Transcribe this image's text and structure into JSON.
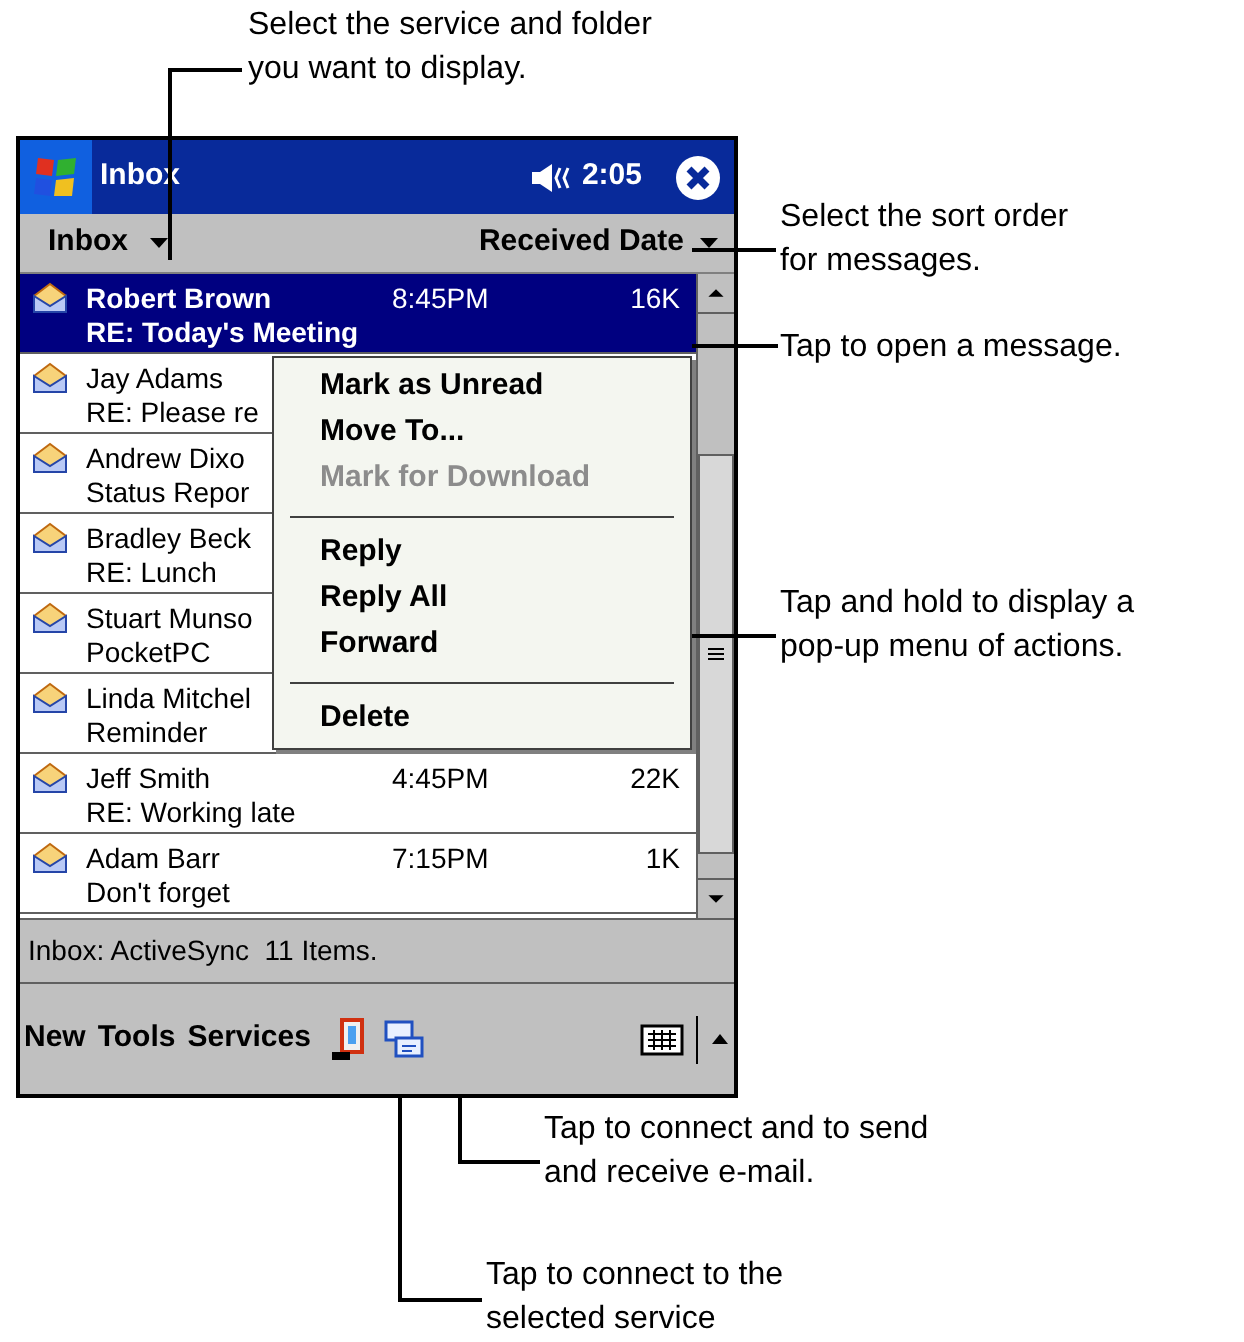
{
  "title_bar": {
    "title": "Inbox",
    "time": "2:05"
  },
  "toolbar": {
    "folder": "Inbox",
    "sort": "Received Date"
  },
  "messages": [
    {
      "sender": "Robert Brown",
      "subject": "RE: Today's Meeting",
      "time": "8:45PM",
      "size": "16K",
      "selected": true
    },
    {
      "sender": "Jay Adams",
      "subject": "RE: Please re",
      "selected": false
    },
    {
      "sender": "Andrew Dixo",
      "subject": "Status Repor",
      "selected": false
    },
    {
      "sender": "Bradley Beck",
      "subject": "RE: Lunch",
      "selected": false
    },
    {
      "sender": "Stuart Munso",
      "subject": "PocketPC",
      "selected": false
    },
    {
      "sender": "Linda Mitchel",
      "subject": "Reminder",
      "selected": false
    },
    {
      "sender": "Jeff Smith",
      "subject": "RE: Working late",
      "time": "4:45PM",
      "size": "22K",
      "selected": false
    },
    {
      "sender": "Adam Barr",
      "subject": "Don't forget",
      "time": "7:15PM",
      "size": "1K",
      "selected": false
    }
  ],
  "context_menu": [
    {
      "kind": "item",
      "label": "Mark as Unread",
      "disabled": false
    },
    {
      "kind": "item",
      "label": "Move To...",
      "disabled": false
    },
    {
      "kind": "item",
      "label": "Mark for Download",
      "disabled": true
    },
    {
      "kind": "separator"
    },
    {
      "kind": "item",
      "label": "Reply",
      "disabled": false
    },
    {
      "kind": "item",
      "label": "Reply All",
      "disabled": false
    },
    {
      "kind": "item",
      "label": "Forward",
      "disabled": false
    },
    {
      "kind": "separator"
    },
    {
      "kind": "item",
      "label": "Delete",
      "disabled": false
    }
  ],
  "status": "Inbox: ActiveSync  11 Items.",
  "command_bar": {
    "menus": [
      "New",
      "Tools",
      "Services"
    ]
  },
  "callouts": [
    {
      "lines": [
        "Select the service and folder",
        "you want to display."
      ]
    },
    {
      "lines": [
        "Select the sort order",
        "for messages."
      ]
    },
    {
      "lines": [
        "Tap to open a message."
      ]
    },
    {
      "lines": [
        "Tap and hold to display a",
        "pop-up menu of actions."
      ]
    },
    {
      "lines": [
        "Tap to connect and to send",
        "and receive e-mail."
      ]
    },
    {
      "lines": [
        "Tap to connect to the",
        "selected service"
      ]
    }
  ]
}
